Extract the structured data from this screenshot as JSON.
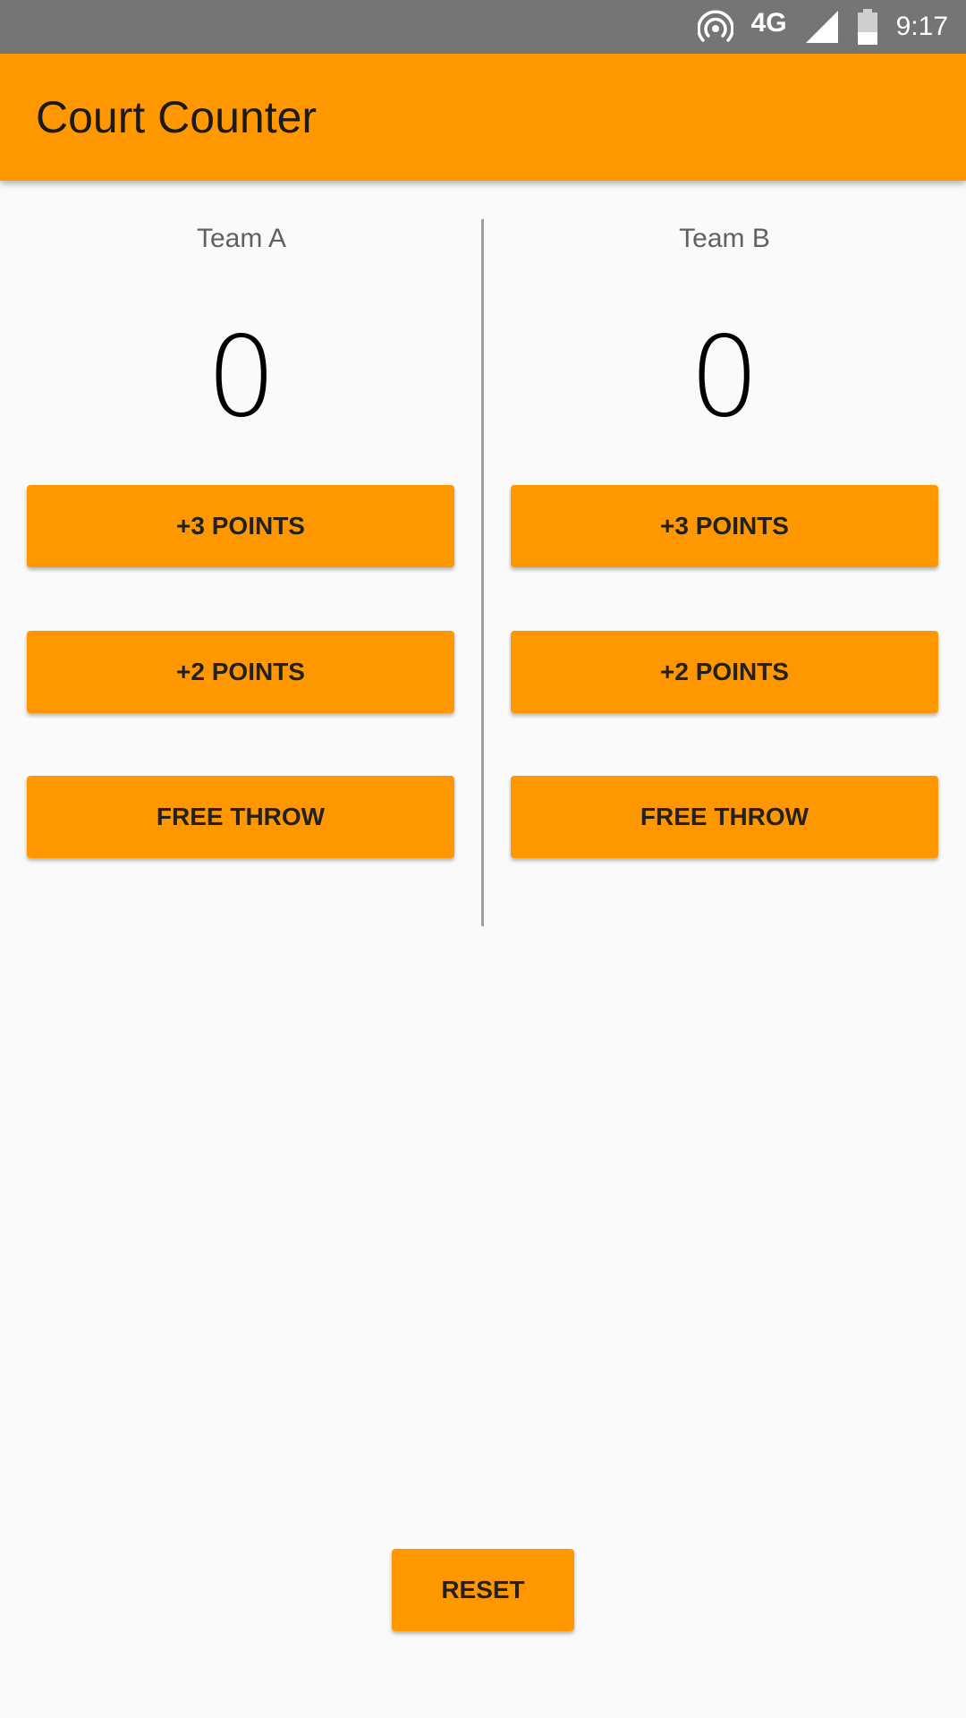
{
  "status_bar": {
    "network": "4G",
    "time": "9:17",
    "icons": [
      "hotspot-icon",
      "signal-icon",
      "battery-icon"
    ]
  },
  "app_bar": {
    "title": "Court Counter",
    "color": "#ff9800"
  },
  "team_a": {
    "name": "Team A",
    "score": "0",
    "buttons": {
      "three": "+3 POINTS",
      "two": "+2 POINTS",
      "free": "FREE THROW"
    }
  },
  "team_b": {
    "name": "Team B",
    "score": "0",
    "buttons": {
      "three": "+3 POINTS",
      "two": "+2 POINTS",
      "free": "FREE THROW"
    }
  },
  "reset_label": "RESET",
  "colors": {
    "accent": "#ff9800",
    "status_bar": "#757575",
    "background": "#fafafa"
  }
}
